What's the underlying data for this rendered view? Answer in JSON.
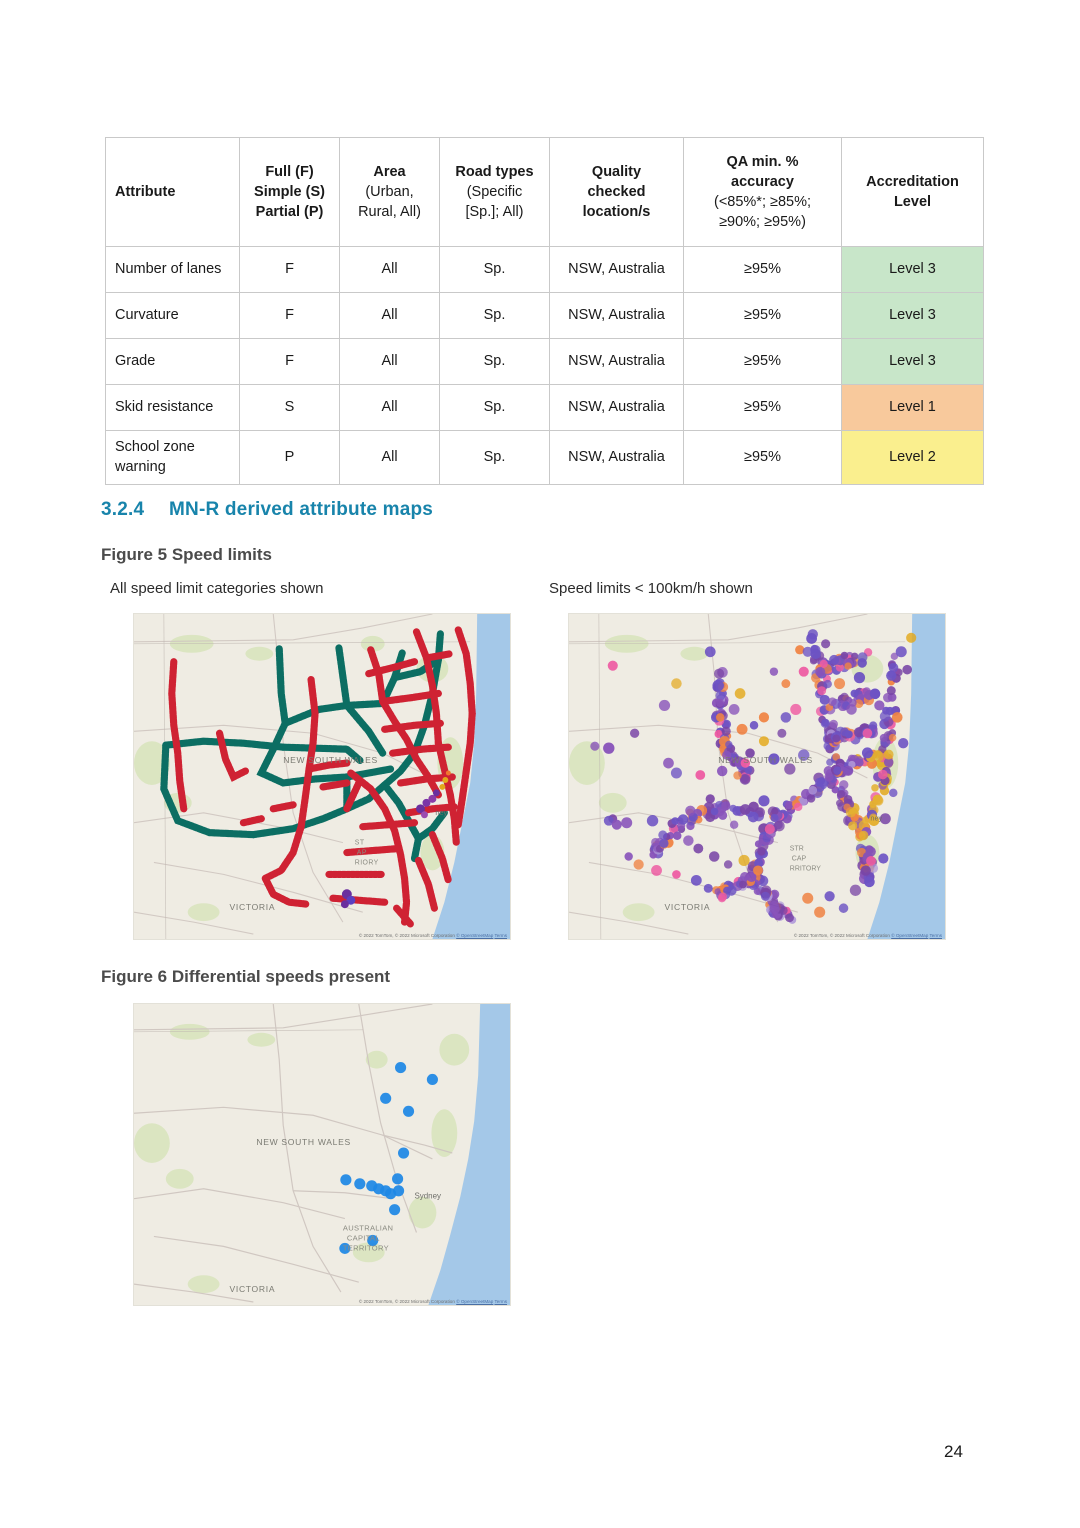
{
  "table": {
    "headers": [
      {
        "main": "Attribute",
        "subs": []
      },
      {
        "main": "Full (F)\nSimple (S)\nPartial (P)",
        "subs": []
      },
      {
        "main": "Area",
        "subs": [
          "(Urban,",
          "Rural, All)"
        ]
      },
      {
        "main": "Road types",
        "subs": [
          "(Specific",
          "[Sp.]; All)"
        ]
      },
      {
        "main": "Quality\nchecked\nlocation/s",
        "subs": []
      },
      {
        "main": "QA min. %\naccuracy",
        "subs": [
          "(<85%*; ≥85%;",
          "≥90%; ≥95%)"
        ]
      },
      {
        "main": "Accreditation\nLevel",
        "subs": []
      }
    ],
    "header_labels": {
      "attribute": "Attribute",
      "full_l1": "Full (F)",
      "full_l2": "Simple (S)",
      "full_l3": "Partial (P)",
      "area": "Area",
      "area_sub1": "(Urban,",
      "area_sub2": "Rural, All)",
      "roadtypes": "Road types",
      "roadtypes_sub1": "(Specific",
      "roadtypes_sub2": "[Sp.]; All)",
      "quality_l1": "Quality",
      "quality_l2": "checked",
      "quality_l3": "location/s",
      "qa_l1": "QA min. %",
      "qa_l2": "accuracy",
      "qa_sub1": "(<85%*; ≥85%;",
      "qa_sub2": "≥90%; ≥95%)",
      "accred_l1": "Accreditation",
      "accred_l2": "Level"
    },
    "rows": [
      {
        "attribute": "Number of lanes",
        "fsp": "F",
        "area": "All",
        "road_types": "Sp.",
        "quality_location": "NSW, Australia",
        "qa_accuracy": "≥95%",
        "accreditation": "Level 3",
        "level_color": "#c8e6c9"
      },
      {
        "attribute": "Curvature",
        "fsp": "F",
        "area": "All",
        "road_types": "Sp.",
        "quality_location": "NSW, Australia",
        "qa_accuracy": "≥95%",
        "accreditation": "Level 3",
        "level_color": "#c8e6c9"
      },
      {
        "attribute": "Grade",
        "fsp": "F",
        "area": "All",
        "road_types": "Sp.",
        "quality_location": "NSW, Australia",
        "qa_accuracy": "≥95%",
        "accreditation": "Level 3",
        "level_color": "#c8e6c9"
      },
      {
        "attribute": "Skid resistance",
        "fsp": "S",
        "area": "All",
        "road_types": "Sp.",
        "quality_location": "NSW, Australia",
        "qa_accuracy": "≥95%",
        "accreditation": "Level 1",
        "level_color": "#f8c99c"
      },
      {
        "attribute": "School zone warning",
        "fsp": "P",
        "area": "All",
        "road_types": "Sp.",
        "quality_location": "NSW, Australia",
        "qa_accuracy": "≥95%",
        "accreditation": "Level 2",
        "level_color": "#faef8e"
      }
    ]
  },
  "section": {
    "number": "3.2.4",
    "title": "MN-R derived attribute maps",
    "color": "#1884ab"
  },
  "figures": [
    {
      "caption": "Figure 5 Speed limits",
      "maps": [
        {
          "subtitle": "All speed limit categories shown",
          "attribution": "© 2022 TomTom, © 2022 Microsoft Corporation",
          "attribution_link1": "© OpenStreetMap",
          "attribution_link2": "Terms"
        },
        {
          "subtitle": "Speed limits < 100km/h shown",
          "attribution": "© 2022 TomTom, © 2022 Microsoft Corporation",
          "attribution_link1": "© OpenStreetMap",
          "attribution_link2": "Terms"
        }
      ]
    },
    {
      "caption": "Figure 6 Differential speeds present",
      "maps": [
        {
          "subtitle": "",
          "attribution": "© 2022 TomTom, © 2022 Microsoft Corporation",
          "attribution_link1": "© OpenStreetMap",
          "attribution_link2": "Terms"
        }
      ]
    }
  ],
  "map_labels": {
    "nsw": "NEW SOUTH WALES",
    "victoria": "VICTORIA",
    "act_l1": "AUSTRALIAN",
    "act_l2": "CAPITAL",
    "act_l3": "TERRITORY",
    "sydney": "Sydney"
  },
  "map_colors": {
    "land": "#efece3",
    "water": "#a4c8e8",
    "park": "#d6e3b6",
    "road": "#cfc6c0",
    "road_red": "#cf2233",
    "road_teal": "#0c6e63",
    "dot_purple": "#6a2f9e",
    "dot_indigo": "#5c3fc0",
    "dot_orange": "#f0762f",
    "dot_gold": "#e3a81a",
    "dot_pink": "#ee4a9b",
    "dot_blue": "#1e88e5"
  },
  "page_number": "24"
}
